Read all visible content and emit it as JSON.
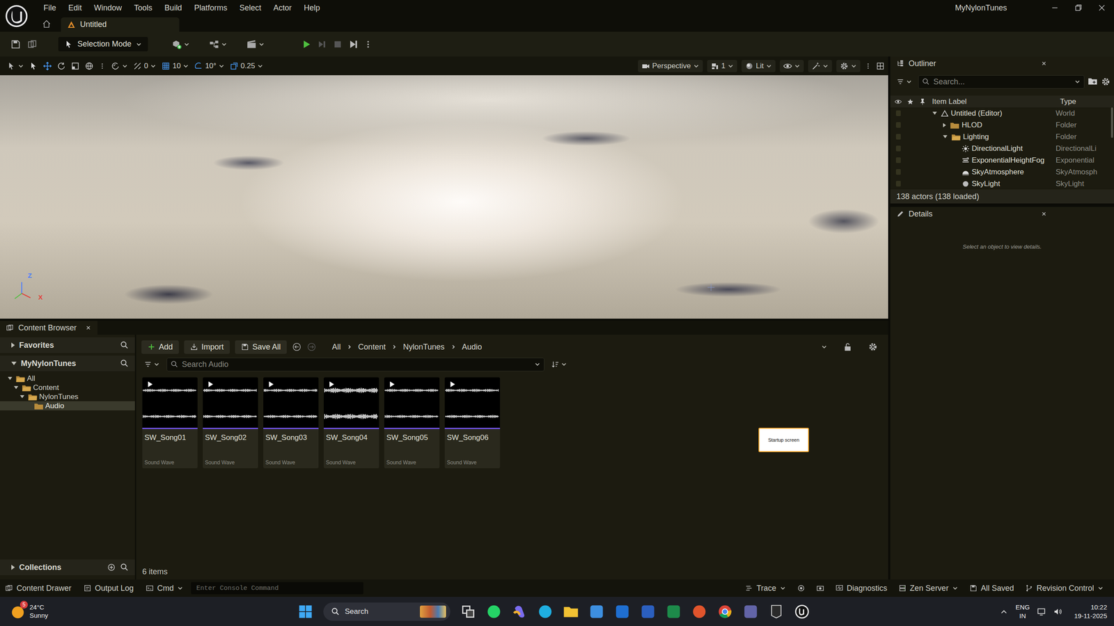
{
  "window": {
    "project": "MyNylonTunes"
  },
  "menu": [
    "File",
    "Edit",
    "Window",
    "Tools",
    "Build",
    "Platforms",
    "Select",
    "Actor",
    "Help"
  ],
  "level_tab": {
    "label": "Untitled",
    "selected": true
  },
  "toolbar": {
    "mode": "Selection Mode"
  },
  "viewport_toolbar": {
    "snaps": [
      "0",
      "10",
      "10°",
      "0.25"
    ],
    "view": "Perspective",
    "layout": "1",
    "view_mode": "Lit"
  },
  "viewport": {
    "axes": [
      {
        "label": "Z",
        "color": "#4a7cff"
      },
      {
        "label": "X",
        "color": "#e0413a"
      }
    ]
  },
  "content_browser": {
    "title": "Content Browser",
    "actions": [
      "Add",
      "Import",
      "Save All"
    ],
    "breadcrumb": [
      "All",
      "Content",
      "NylonTunes",
      "Audio"
    ],
    "search_placeholder": "Search Audio",
    "favorites": "Favorites",
    "project": "MyNylonTunes",
    "tree": [
      {
        "label": "All",
        "depth": 0,
        "expandable": true,
        "expanded": true,
        "selected": false
      },
      {
        "label": "Content",
        "depth": 1,
        "expandable": true,
        "expanded": true,
        "selected": false
      },
      {
        "label": "NylonTunes",
        "depth": 2,
        "expandable": true,
        "expanded": true,
        "selected": false
      },
      {
        "label": "Audio",
        "depth": 3,
        "expandable": false,
        "selected": true
      }
    ],
    "collections": "Collections",
    "assets": [
      {
        "name": "SW_Song01",
        "type": "Sound Wave"
      },
      {
        "name": "SW_Song02",
        "type": "Sound Wave"
      },
      {
        "name": "SW_Song03",
        "type": "Sound Wave"
      },
      {
        "name": "SW_Song04",
        "type": "Sound Wave"
      },
      {
        "name": "SW_Song05",
        "type": "Sound Wave"
      },
      {
        "name": "SW_Song06",
        "type": "Sound Wave"
      }
    ],
    "item_count": "6 items",
    "floating_label": "Startup screen"
  },
  "outliner": {
    "title": "Outliner",
    "search_placeholder": "Search...",
    "columns": [
      "Item Label",
      "Type"
    ],
    "rows": [
      {
        "label": "Untitled (Editor)",
        "type": "World",
        "depth": 0,
        "kind": "level",
        "expanded": true
      },
      {
        "label": "HLOD",
        "type": "Folder",
        "depth": 1,
        "kind": "folder",
        "expanded": false
      },
      {
        "label": "Lighting",
        "type": "Folder",
        "depth": 1,
        "kind": "folder",
        "expanded": true
      },
      {
        "label": "DirectionalLight",
        "type": "DirectionalLi",
        "depth": 2,
        "kind": "light"
      },
      {
        "label": "ExponentialHeightFog",
        "type": "Exponential",
        "depth": 2,
        "kind": "fog"
      },
      {
        "label": "SkyAtmosphere",
        "type": "SkyAtmosph",
        "depth": 2,
        "kind": "sky"
      },
      {
        "label": "SkyLight",
        "type": "SkyLight",
        "depth": 2,
        "kind": "skylight"
      }
    ],
    "summary": "138 actors (138 loaded)"
  },
  "details": {
    "title": "Details",
    "empty_message": "Select an object to view details."
  },
  "status_bar": {
    "drawers": [
      "Content Drawer",
      "Output Log"
    ],
    "cmd": "Cmd",
    "console_placeholder": "Enter Console Command",
    "right": [
      "Trace",
      "Diagnostics",
      "Zen Server",
      "All Saved",
      "Revision Control"
    ]
  },
  "taskbar": {
    "temperature": "24°C",
    "condition": "Sunny",
    "badge": "5",
    "search": "Search",
    "language": "ENG",
    "region": "IN",
    "time": "10:22",
    "date": "19-11-2025"
  }
}
